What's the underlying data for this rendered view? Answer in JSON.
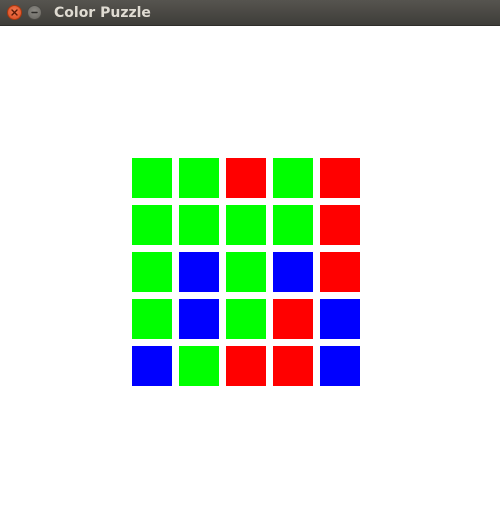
{
  "window": {
    "title": "Color Puzzle",
    "buttons": [
      {
        "name": "close",
        "icon": "close-icon"
      },
      {
        "name": "minimize",
        "icon": "minimize-icon"
      }
    ]
  },
  "palette": {
    "green": "#00ff00",
    "red": "#ff0000",
    "blue": "#0000ff"
  },
  "grid": {
    "rows": 5,
    "cols": 5,
    "cells": [
      [
        "green",
        "green",
        "red",
        "green",
        "red"
      ],
      [
        "green",
        "green",
        "green",
        "green",
        "red"
      ],
      [
        "green",
        "blue",
        "green",
        "blue",
        "red"
      ],
      [
        "green",
        "blue",
        "green",
        "red",
        "blue"
      ],
      [
        "blue",
        "green",
        "red",
        "red",
        "blue"
      ]
    ]
  }
}
